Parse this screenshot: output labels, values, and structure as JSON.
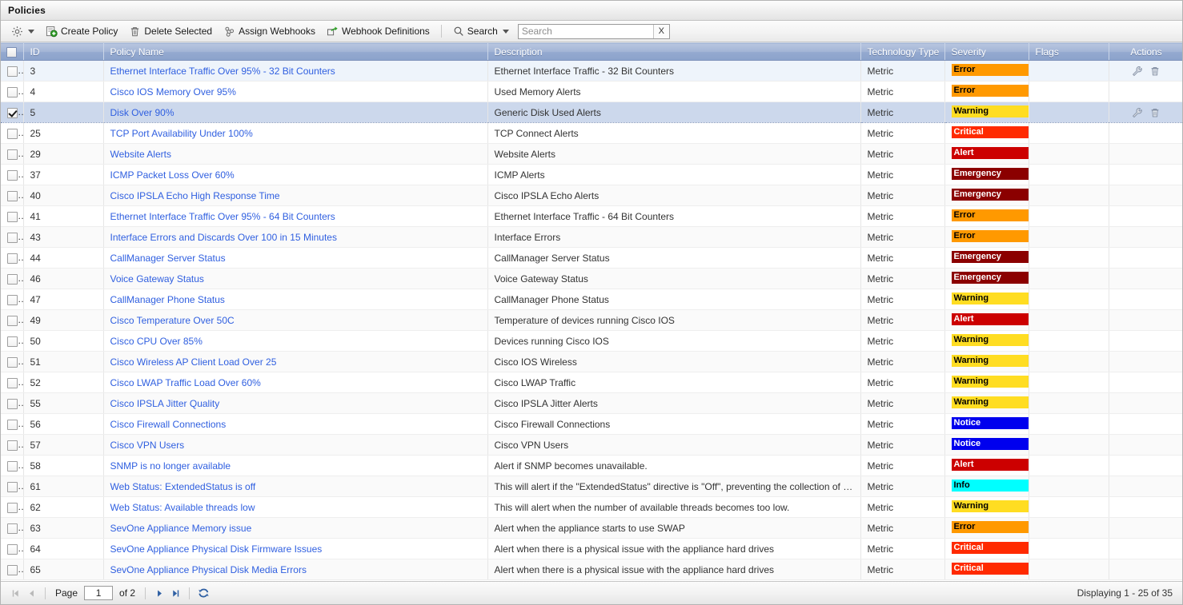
{
  "window": {
    "title": "Policies"
  },
  "toolbar": {
    "settings_icon": "gear-icon",
    "items": [
      {
        "label": "Create Policy",
        "icon": "create-policy-icon"
      },
      {
        "label": "Delete Selected",
        "icon": "trash-icon"
      },
      {
        "label": "Assign Webhooks",
        "icon": "webhook-icon"
      },
      {
        "label": "Webhook Definitions",
        "icon": "webhook-definitions-icon"
      }
    ],
    "search_menu_label": "Search",
    "search_menu_icon": "search-icon",
    "search_placeholder": "Search",
    "search_value": "",
    "search_clear_label": "X"
  },
  "columns": [
    {
      "key": "check",
      "label": ""
    },
    {
      "key": "id",
      "label": "ID"
    },
    {
      "key": "name",
      "label": "Policy Name"
    },
    {
      "key": "description",
      "label": "Description"
    },
    {
      "key": "technology",
      "label": "Technology Type"
    },
    {
      "key": "severity",
      "label": "Severity"
    },
    {
      "key": "flags",
      "label": "Flags"
    },
    {
      "key": "actions",
      "label": "Actions"
    }
  ],
  "severity_colors": {
    "Error": {
      "bg": "#FF9900",
      "fg": "#000000"
    },
    "Warning": {
      "bg": "#FFDD22",
      "fg": "#000000"
    },
    "Critical": {
      "bg": "#FF2A00",
      "fg": "#FFFFFF"
    },
    "Alert": {
      "bg": "#CC0000",
      "fg": "#FFFFFF"
    },
    "Emergency": {
      "bg": "#8B0000",
      "fg": "#FFFFFF"
    },
    "Notice": {
      "bg": "#0000EE",
      "fg": "#FFFFFF"
    },
    "Info": {
      "bg": "#00FFFF",
      "fg": "#000000"
    }
  },
  "rows": [
    {
      "checked": false,
      "id": "3",
      "name": "Ethernet Interface Traffic Over 95% - 32 Bit Counters",
      "description": "Ethernet Interface Traffic - 32 Bit Counters",
      "technology": "Metric",
      "severity": "Error",
      "flags": "",
      "actions": true,
      "highlight": true
    },
    {
      "checked": false,
      "id": "4",
      "name": "Cisco IOS Memory Over 95%",
      "description": "Used Memory Alerts",
      "technology": "Metric",
      "severity": "Error",
      "flags": "",
      "actions": false,
      "highlight": false
    },
    {
      "checked": true,
      "id": "5",
      "name": "Disk Over 90%",
      "description": "Generic Disk Used Alerts",
      "technology": "Metric",
      "severity": "Warning",
      "flags": "",
      "actions": true,
      "selected": true
    },
    {
      "checked": false,
      "id": "25",
      "name": "TCP Port Availability Under 100%",
      "description": "TCP Connect Alerts",
      "technology": "Metric",
      "severity": "Critical",
      "flags": "",
      "actions": false
    },
    {
      "checked": false,
      "id": "29",
      "name": "Website Alerts",
      "description": "Website Alerts",
      "technology": "Metric",
      "severity": "Alert",
      "flags": "",
      "actions": false
    },
    {
      "checked": false,
      "id": "37",
      "name": "ICMP Packet Loss Over 60%",
      "description": "ICMP Alerts",
      "technology": "Metric",
      "severity": "Emergency",
      "flags": "",
      "actions": false
    },
    {
      "checked": false,
      "id": "40",
      "name": "Cisco IPSLA Echo High Response Time",
      "description": "Cisco IPSLA Echo Alerts",
      "technology": "Metric",
      "severity": "Emergency",
      "flags": "",
      "actions": false
    },
    {
      "checked": false,
      "id": "41",
      "name": "Ethernet Interface Traffic Over 95% - 64 Bit Counters",
      "description": "Ethernet Interface Traffic - 64 Bit Counters",
      "technology": "Metric",
      "severity": "Error",
      "flags": "",
      "actions": false
    },
    {
      "checked": false,
      "id": "43",
      "name": "Interface Errors and Discards Over 100 in 15 Minutes",
      "description": "Interface Errors",
      "technology": "Metric",
      "severity": "Error",
      "flags": "",
      "actions": false
    },
    {
      "checked": false,
      "id": "44",
      "name": "CallManager Server Status",
      "description": "CallManager Server Status",
      "technology": "Metric",
      "severity": "Emergency",
      "flags": "",
      "actions": false
    },
    {
      "checked": false,
      "id": "46",
      "name": "Voice Gateway Status",
      "description": "Voice Gateway Status",
      "technology": "Metric",
      "severity": "Emergency",
      "flags": "",
      "actions": false
    },
    {
      "checked": false,
      "id": "47",
      "name": "CallManager Phone Status",
      "description": "CallManager Phone Status",
      "technology": "Metric",
      "severity": "Warning",
      "flags": "",
      "actions": false
    },
    {
      "checked": false,
      "id": "49",
      "name": "Cisco Temperature Over 50C",
      "description": "Temperature of devices running Cisco IOS",
      "technology": "Metric",
      "severity": "Alert",
      "flags": "",
      "actions": false
    },
    {
      "checked": false,
      "id": "50",
      "name": "Cisco CPU Over 85%",
      "description": "Devices running Cisco IOS",
      "technology": "Metric",
      "severity": "Warning",
      "flags": "",
      "actions": false
    },
    {
      "checked": false,
      "id": "51",
      "name": "Cisco Wireless AP Client Load Over 25",
      "description": "Cisco IOS Wireless",
      "technology": "Metric",
      "severity": "Warning",
      "flags": "",
      "actions": false
    },
    {
      "checked": false,
      "id": "52",
      "name": "Cisco LWAP Traffic Load Over 60%",
      "description": "Cisco LWAP Traffic",
      "technology": "Metric",
      "severity": "Warning",
      "flags": "",
      "actions": false
    },
    {
      "checked": false,
      "id": "55",
      "name": "Cisco IPSLA Jitter Quality",
      "description": "Cisco IPSLA Jitter Alerts",
      "technology": "Metric",
      "severity": "Warning",
      "flags": "",
      "actions": false
    },
    {
      "checked": false,
      "id": "56",
      "name": "Cisco Firewall Connections",
      "description": "Cisco Firewall Connections",
      "technology": "Metric",
      "severity": "Notice",
      "flags": "",
      "actions": false
    },
    {
      "checked": false,
      "id": "57",
      "name": "Cisco VPN Users",
      "description": "Cisco VPN Users",
      "technology": "Metric",
      "severity": "Notice",
      "flags": "",
      "actions": false
    },
    {
      "checked": false,
      "id": "58",
      "name": "SNMP is no longer available",
      "description": "Alert if SNMP becomes unavailable.",
      "technology": "Metric",
      "severity": "Alert",
      "flags": "",
      "actions": false
    },
    {
      "checked": false,
      "id": "61",
      "name": "Web Status: ExtendedStatus is off",
      "description": "This will alert if the \"ExtendedStatus\" directive is \"Off\", preventing the collection of additional...",
      "technology": "Metric",
      "severity": "Info",
      "flags": "",
      "actions": false
    },
    {
      "checked": false,
      "id": "62",
      "name": "Web Status: Available threads low",
      "description": "This will alert when the number of available threads becomes too low.",
      "technology": "Metric",
      "severity": "Warning",
      "flags": "",
      "actions": false
    },
    {
      "checked": false,
      "id": "63",
      "name": "SevOne Appliance Memory issue",
      "description": "Alert when the appliance starts to use SWAP",
      "technology": "Metric",
      "severity": "Error",
      "flags": "",
      "actions": false
    },
    {
      "checked": false,
      "id": "64",
      "name": "SevOne Appliance Physical Disk Firmware Issues",
      "description": "Alert when there is a physical issue with the appliance hard drives",
      "technology": "Metric",
      "severity": "Critical",
      "flags": "",
      "actions": false
    },
    {
      "checked": false,
      "id": "65",
      "name": "SevOne Appliance Physical Disk Media Errors",
      "description": "Alert when there is a physical issue with the appliance hard drives",
      "technology": "Metric",
      "severity": "Critical",
      "flags": "",
      "actions": false
    }
  ],
  "footer": {
    "first_icon": "first-page-icon",
    "prev_icon": "prev-page-icon",
    "page_label": "Page",
    "page_value": "1",
    "of_label": "of 2",
    "next_icon": "next-page-icon",
    "last_icon": "last-page-icon",
    "refresh_icon": "refresh-icon",
    "display_text": "Displaying 1 - 25 of 35"
  }
}
